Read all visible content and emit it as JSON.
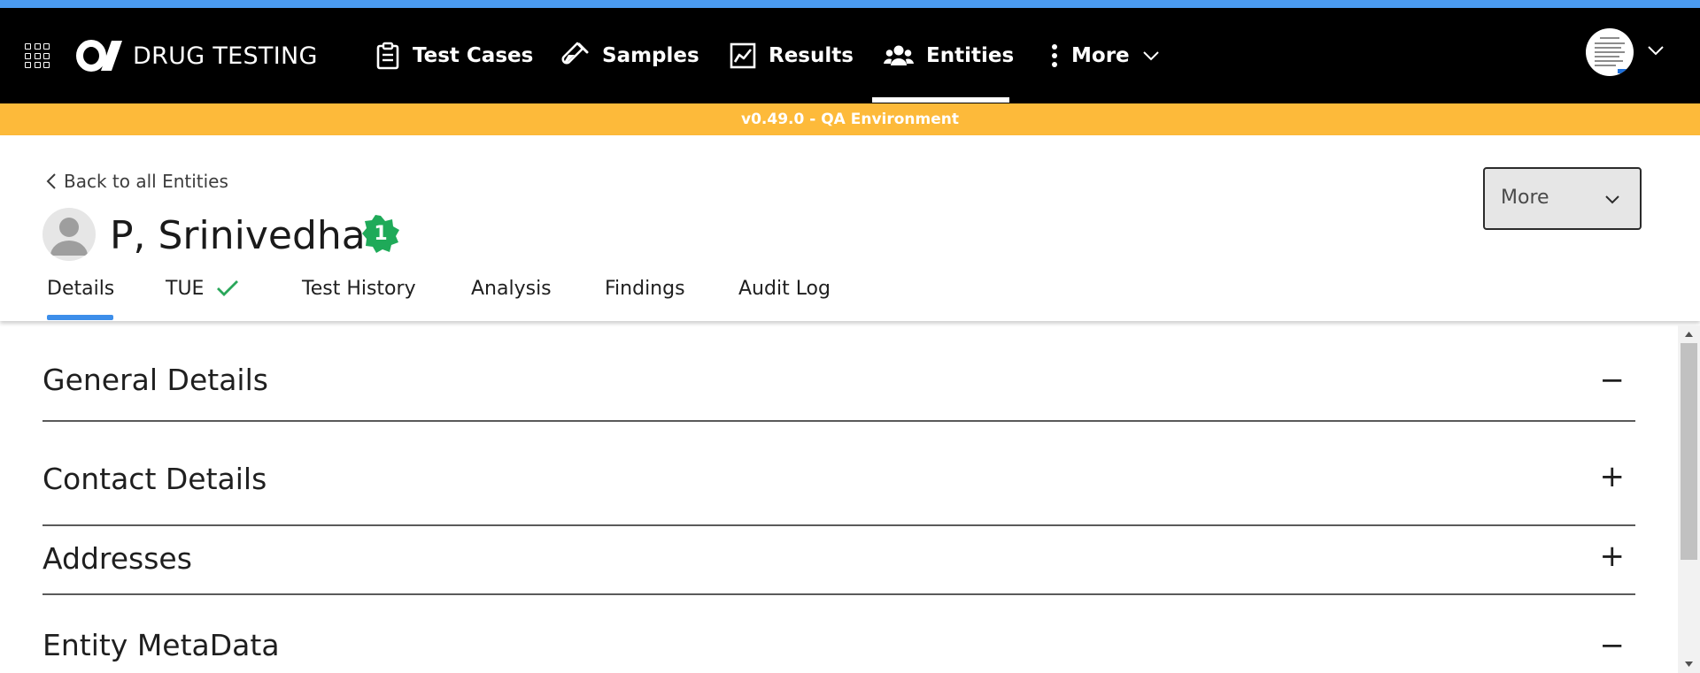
{
  "app": {
    "brand": "DRUG TESTING",
    "nav": [
      {
        "label": "Test Cases",
        "icon": "clipboard-icon"
      },
      {
        "label": "Samples",
        "icon": "test-tube-icon"
      },
      {
        "label": "Results",
        "icon": "chart-line-icon"
      },
      {
        "label": "Entities",
        "icon": "users-icon"
      },
      {
        "label": "More",
        "icon": "vertical-dots-icon"
      }
    ],
    "active_nav": "Entities"
  },
  "banner": {
    "text": "v0.49.0 - QA Environment"
  },
  "header": {
    "back_label": "Back to all Entities",
    "entity_name": "P, Srinivedha",
    "badge_count": "1",
    "more_button": "More"
  },
  "tabs": [
    {
      "label": "Details"
    },
    {
      "label": "TUE"
    },
    {
      "label": "Test History"
    },
    {
      "label": "Analysis"
    },
    {
      "label": "Findings"
    },
    {
      "label": "Audit Log"
    }
  ],
  "active_tab": "Details",
  "sections": [
    {
      "title": "General Details",
      "toggle": "−"
    },
    {
      "title": "Contact Details",
      "toggle": "+"
    },
    {
      "title": "Addresses",
      "toggle": "+"
    },
    {
      "title": "Entity MetaData",
      "toggle": "−"
    }
  ],
  "colors": {
    "accent_blue": "#4b9bf0",
    "banner_orange": "#fdba3a",
    "badge_green": "#1faa59",
    "check_green": "#2aa75a"
  }
}
